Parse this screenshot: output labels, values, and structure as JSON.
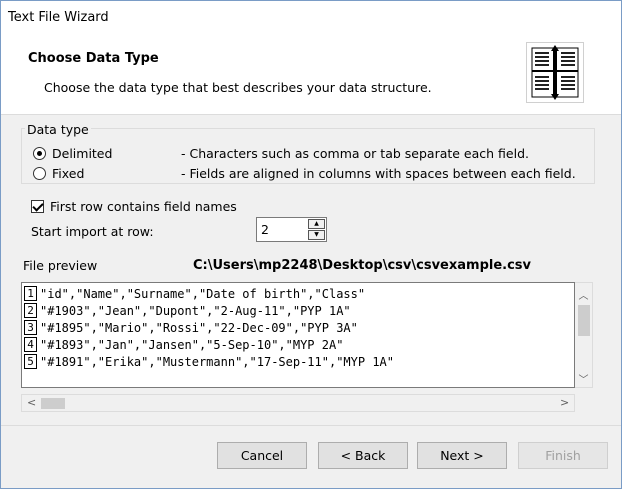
{
  "window": {
    "title": "Text File Wizard"
  },
  "header": {
    "title": "Choose Data Type",
    "subtitle": "Choose the data type that best describes your data structure."
  },
  "data_type": {
    "group_label": "Data type",
    "options": [
      {
        "label": "Delimited",
        "description": "- Characters such as comma or tab separate each field.",
        "selected": true
      },
      {
        "label": "Fixed",
        "description": "- Fields are aligned in columns with spaces between each field.",
        "selected": false
      }
    ]
  },
  "first_row": {
    "label": "First row contains field names",
    "checked": true
  },
  "start_import": {
    "label": "Start import at row:",
    "value": "2"
  },
  "preview": {
    "label": "File preview",
    "file_path": "C:\\Users\\mp2248\\Desktop\\csv\\csvexample.csv",
    "rows": [
      {
        "num": "1",
        "text": "\"id\",\"Name\",\"Surname\",\"Date of birth\",\"Class\""
      },
      {
        "num": "2",
        "text": "\"#1903\",\"Jean\",\"Dupont\",\"2-Aug-11\",\"PYP 1A\""
      },
      {
        "num": "3",
        "text": "\"#1895\",\"Mario\",\"Rossi\",\"22-Dec-09\",\"PYP 3A\""
      },
      {
        "num": "4",
        "text": "\"#1893\",\"Jan\",\"Jansen\",\"5-Sep-10\",\"MYP 2A\""
      },
      {
        "num": "5",
        "text": "\"#1891\",\"Erika\",\"Mustermann\",\"17-Sep-11\",\"MYP 1A\""
      }
    ]
  },
  "buttons": {
    "cancel": "Cancel",
    "back": "< Back",
    "next": "Next >",
    "finish": "Finish"
  }
}
